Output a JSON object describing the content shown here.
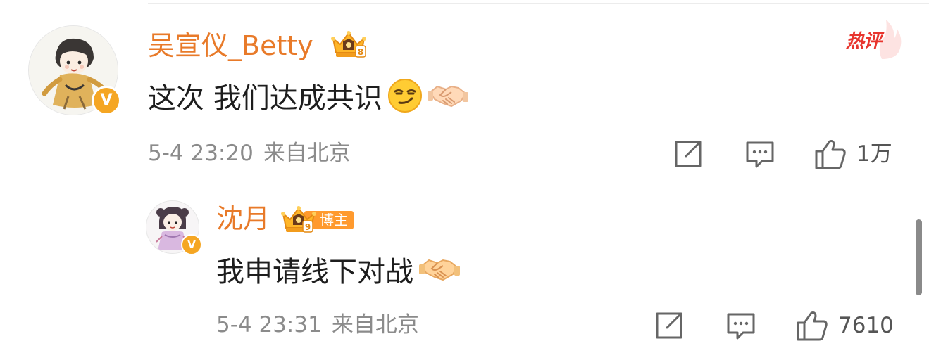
{
  "comments": [
    {
      "username": "吴宣仪_Betty",
      "badge_letter": "V",
      "hot_label": "热评",
      "text": "这次 我们达成共识",
      "date": "5-4 23:20",
      "location": "来自北京",
      "likes": "1万",
      "icons": [
        "smirk-emoji",
        "handshake-emoji",
        "share-icon",
        "comment-icon",
        "like-icon"
      ]
    },
    {
      "username": "沈月",
      "badge_letter": "V",
      "tag": "博主",
      "text": "我申请线下对战",
      "date": "5-4 23:31",
      "location": "来自北京",
      "likes": "7610",
      "icons": [
        "handshake-emoji",
        "share-icon",
        "comment-icon",
        "like-icon"
      ]
    }
  ],
  "colors": {
    "username": "#e87a29",
    "hot": "#e8352e",
    "badge": "#f5a623",
    "tag": "#ff9a2e",
    "meta": "#8b8b8b"
  }
}
